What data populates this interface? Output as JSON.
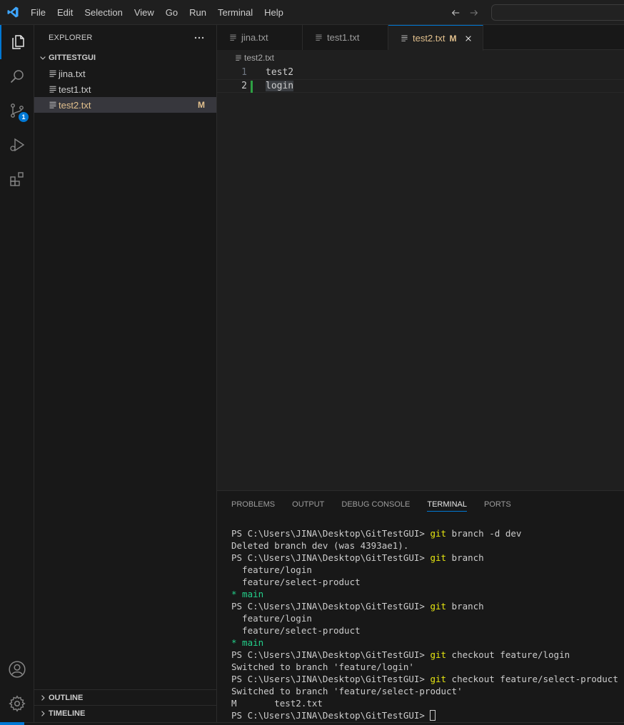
{
  "menu": [
    "File",
    "Edit",
    "Selection",
    "View",
    "Go",
    "Run",
    "Terminal",
    "Help"
  ],
  "activity_bar": {
    "source_control_badge": "1"
  },
  "sidebar": {
    "title": "EXPLORER",
    "folder": "GITTESTGUI",
    "files": [
      {
        "name": "jina.txt",
        "status": ""
      },
      {
        "name": "test1.txt",
        "status": ""
      },
      {
        "name": "test2.txt",
        "status": "M"
      }
    ],
    "outline": "OUTLINE",
    "timeline": "TIMELINE"
  },
  "tabs": [
    {
      "label": "jina.txt"
    },
    {
      "label": "test1.txt"
    },
    {
      "label": "test2.txt",
      "modified": "M"
    }
  ],
  "breadcrumb": "test2.txt",
  "editor": {
    "lines": [
      {
        "num": "1",
        "text": "test2"
      },
      {
        "num": "2",
        "text": "login"
      }
    ]
  },
  "panel": {
    "tabs": [
      "PROBLEMS",
      "OUTPUT",
      "DEBUG CONSOLE",
      "TERMINAL",
      "PORTS"
    ],
    "prompt": "PS C:\\Users\\JINA\\Desktop\\GitTestGUI> ",
    "terminal": {
      "l1_cmd": "git",
      "l1_rest": " branch -d dev",
      "l2": "Deleted branch dev (was 4393ae1).",
      "l3_cmd": "git",
      "l3_rest": " branch",
      "l4": "  feature/login",
      "l5": "  feature/select-product",
      "l6": "* main",
      "l7_cmd": "git",
      "l7_rest": " branch",
      "l8": "  feature/login",
      "l9": "  feature/select-product",
      "l10": "* main",
      "l11_cmd": "git",
      "l11_rest": " checkout feature/login",
      "l12": "Switched to branch 'feature/login'",
      "l13_cmd": "git",
      "l13_rest": " checkout feature/select-product",
      "l14": "Switched to branch 'feature/select-product'",
      "l15": "M       test2.txt"
    }
  },
  "colors": {
    "accent": "#0078d4",
    "modified": "#e2c08d",
    "added_gutter": "#2ea043",
    "terminal_command": "#e5e510",
    "terminal_green": "#23d18b"
  }
}
